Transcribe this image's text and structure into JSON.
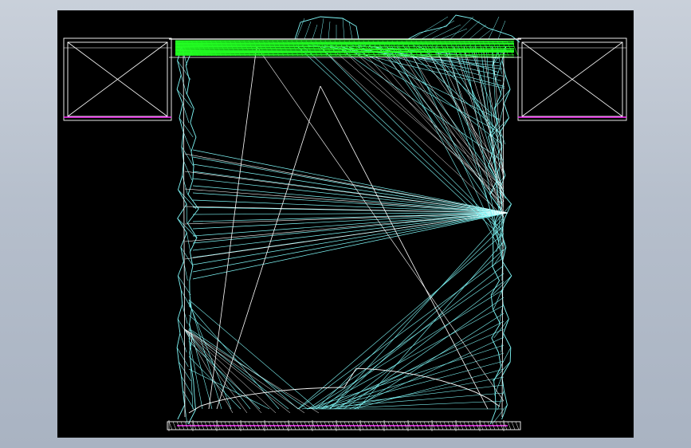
{
  "canvas": {
    "background": "#000000",
    "frame_background": "#b9c1ce"
  },
  "colors": {
    "mesh_cyan": "#7ff7f7",
    "mesh_white": "#ffffff",
    "mesh_green": "#22ff22",
    "accent_magenta": "#ff33ff"
  },
  "model": {
    "description_visible": false
  }
}
